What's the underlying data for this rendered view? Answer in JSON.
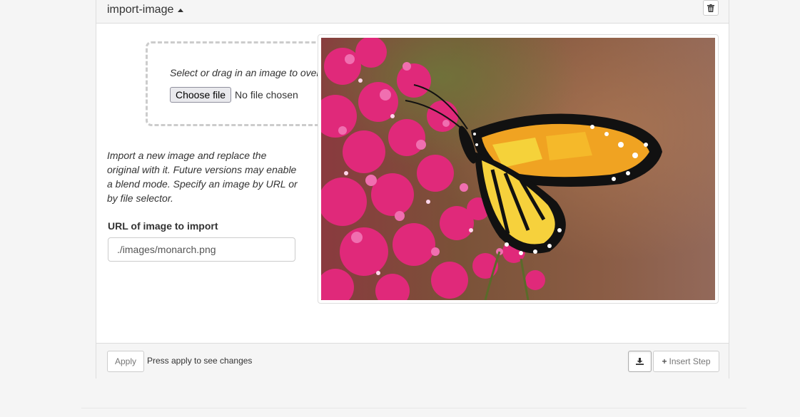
{
  "step": {
    "title": "import-image",
    "colors": {
      "accent": "#333333",
      "panel_border": "#dddddd",
      "footer_bg": "#f5f5f5"
    }
  },
  "header": {
    "caret_icon": "caret-up-icon",
    "delete_icon": "trash-icon"
  },
  "dropzone": {
    "text": "Select or drag in an image to overlay.",
    "file_button_label": "Choose file",
    "file_status": "No file chosen"
  },
  "description": "Import a new image and replace the original with it. Future versions may enable a blend mode. Specify an image by URL or by file selector.",
  "url_field": {
    "label": "URL of image to import",
    "value": "./images/monarch.png"
  },
  "preview": {
    "image_subject": "monarch butterfly on pink flowers"
  },
  "footer": {
    "apply_label": "Apply",
    "apply_hint": "Press apply to see changes",
    "download_icon": "download-icon",
    "insert_label": "Insert Step",
    "insert_icon": "plus-icon"
  }
}
